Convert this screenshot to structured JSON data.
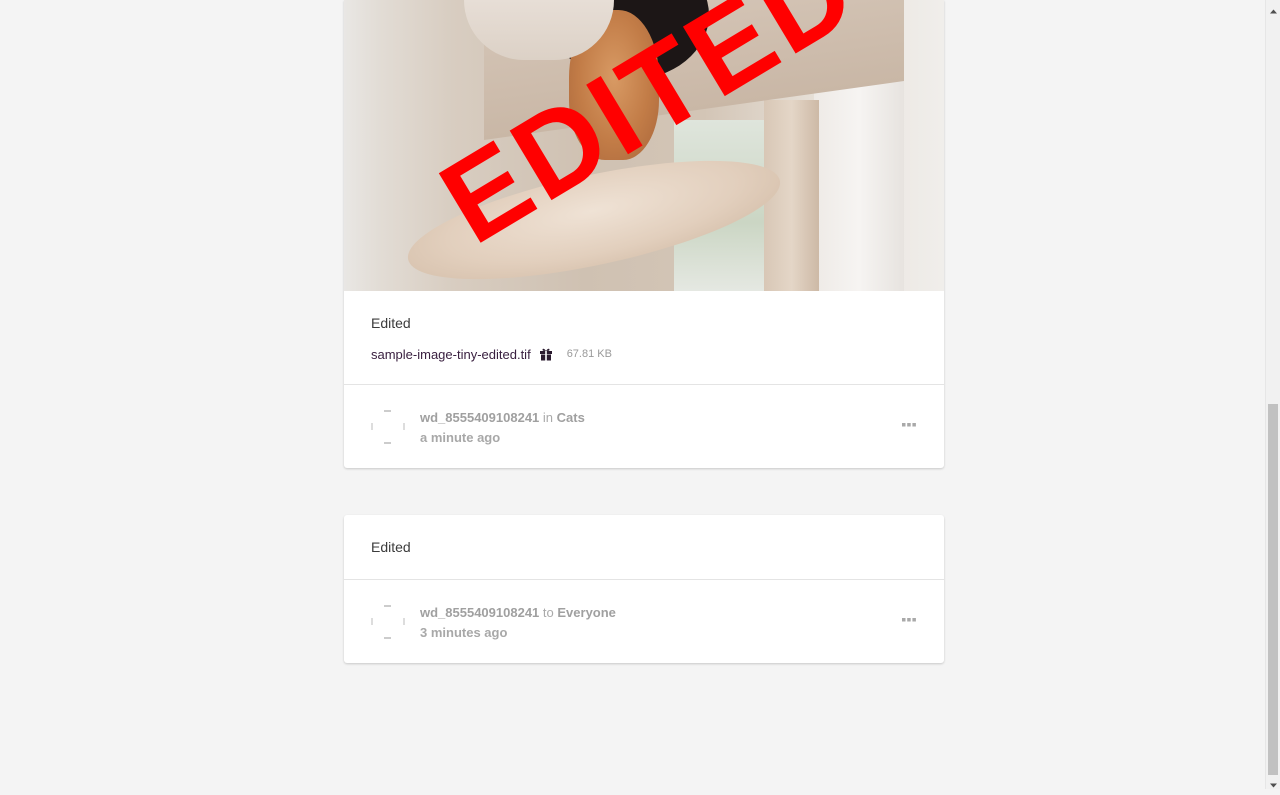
{
  "posts": [
    {
      "image": {
        "stamp_text": "EDITED"
      },
      "title": "Edited",
      "attachment": {
        "file_name": "sample-image-tiny-edited.tif",
        "icon": "gift-icon",
        "file_size": "67.81 KB"
      },
      "meta": {
        "user": "wd_8555409108241",
        "connector": "in",
        "target": "Cats",
        "time": "a minute ago",
        "more_icon": "ellipsis-icon"
      }
    },
    {
      "title": "Edited",
      "meta": {
        "user": "wd_8555409108241",
        "connector": "to",
        "target": "Everyone",
        "time": "3 minutes ago",
        "more_icon": "ellipsis-icon"
      }
    }
  ],
  "colors": {
    "page_background": "#f4f4f4",
    "card_background": "#ffffff",
    "stamp_red": "#ff0000",
    "file_link": "#3a2040",
    "meta_gray": "#a0a0a0",
    "scroll_thumb": "#c1c1c1"
  }
}
